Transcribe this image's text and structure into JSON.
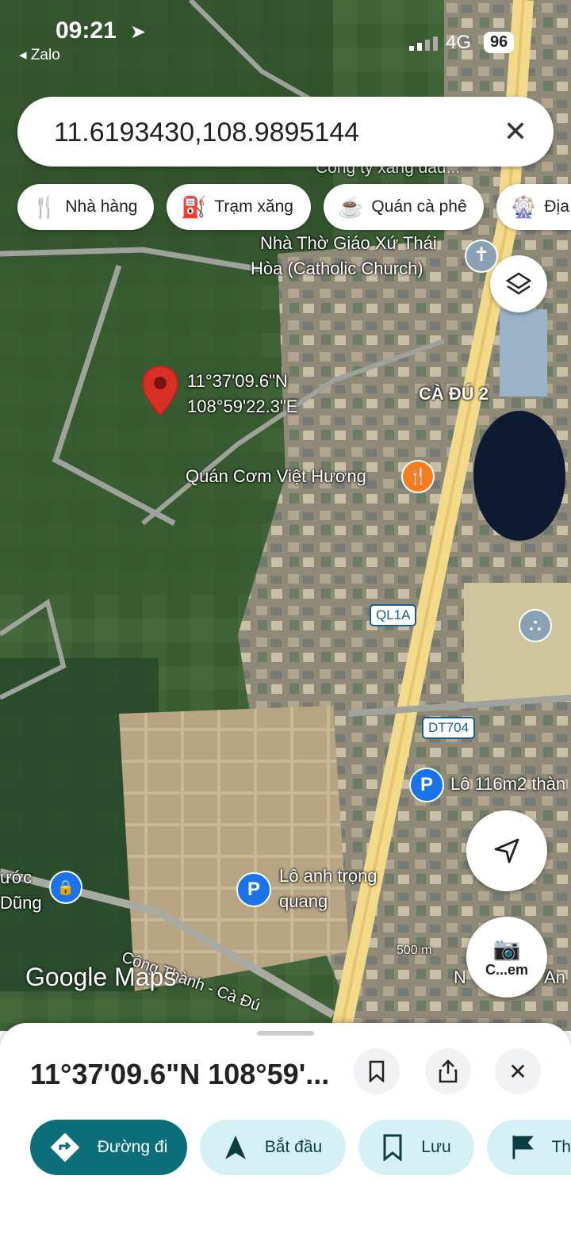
{
  "status_bar": {
    "time": "09:21",
    "back_app": "◂ Zalo",
    "network": "4G",
    "battery": "96"
  },
  "search": {
    "query": "11.6193430,108.9895144"
  },
  "chips": [
    {
      "label": "Nhà hàng",
      "icon": "fork-knife-icon",
      "glyph": "🍴"
    },
    {
      "label": "Trạm xăng",
      "icon": "gas-station-icon",
      "glyph": "⛽"
    },
    {
      "label": "Quán cà phê",
      "icon": "coffee-cup-icon",
      "glyph": "☕"
    },
    {
      "label": "Địa",
      "icon": "ferris-wheel-icon",
      "glyph": "🎡"
    }
  ],
  "map_labels": {
    "company_partial": "Công ty xăng dầu...",
    "church": "Nhà Thờ Giáo Xứ Thái",
    "church_2": "Hòa (Catholic Church)",
    "pin_lat": "11°37'09.6\"N",
    "pin_lon": "108°59'22.3\"E",
    "district": "CÀ ĐÚ 2",
    "restaurant": "Quán Cơm Việt Hương",
    "road_ql1a": "QL1A",
    "road_dt704": "DT704",
    "lot_116": "Lô 116m2 thàn",
    "lot_anh_1": "Lô anh trọng",
    "lot_anh_2": "quang",
    "left_partial_1": "ước",
    "left_partial_2": "Dũng",
    "street": "Công Thành - Cà Đú",
    "scale": "500 m",
    "ncm_partial": "N",
    "camera_label": "C...em",
    "right_partial": "An",
    "brand": "Google Maps"
  },
  "sheet": {
    "title": "11°37'09.6\"N 108°59'...",
    "actions": [
      {
        "label": "Đường đi",
        "icon": "directions-icon"
      },
      {
        "label": "Bắt đầu",
        "icon": "navigation-arrow-icon"
      },
      {
        "label": "Lưu",
        "icon": "bookmark-icon"
      },
      {
        "label": "Th",
        "icon": "flag-icon"
      }
    ]
  },
  "colors": {
    "primary_teal": "#0b6e78",
    "light_teal": "#d6f1f5",
    "pin_red": "#d93025",
    "poi_blue": "#1a73e8",
    "food_orange": "#f57c1f",
    "road_yellow": "#f3d98a"
  }
}
